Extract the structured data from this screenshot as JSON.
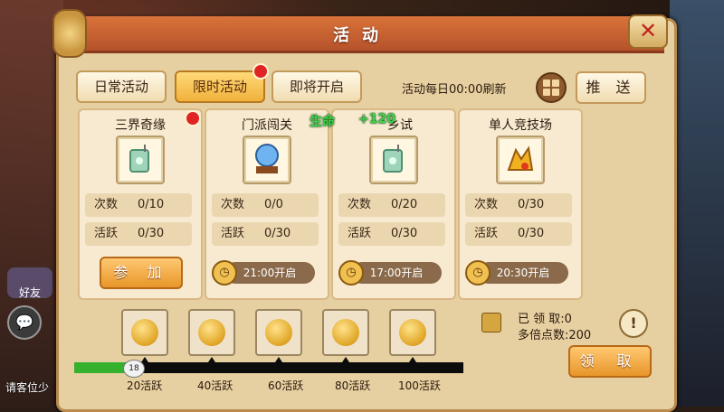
{
  "window": {
    "title": "活动"
  },
  "background": {
    "friend_label": "好友",
    "bottom_left_text": "请客位少"
  },
  "tabs": [
    {
      "label": "日常活动",
      "active": false,
      "red_dot": false
    },
    {
      "label": "限时活动",
      "active": true,
      "red_dot": true
    },
    {
      "label": "即将开启",
      "active": false,
      "red_dot": false
    }
  ],
  "header": {
    "refresh_text": "活动每日00:00刷新",
    "push_label": "推 送",
    "grid_icon": "grid-icon"
  },
  "floating_text": {
    "life": "生命",
    "value": "+120"
  },
  "activities": [
    {
      "name": "三界奇缘",
      "icon": "jade-tag-icon",
      "count_label": "次数",
      "count": "0/10",
      "active_label": "活跃",
      "active": "0/30",
      "action_label": "参 加",
      "red_dot": true
    },
    {
      "name": "门派闯关",
      "icon": "crystal-ball-icon",
      "count_label": "次数",
      "count": "0/0",
      "active_label": "活跃",
      "active": "0/30",
      "time_label": "21:00开启"
    },
    {
      "name": "乡试",
      "icon": "jade-tag-icon",
      "count_label": "次数",
      "count": "0/20",
      "active_label": "活跃",
      "active": "0/30",
      "time_label": "17:00开启"
    },
    {
      "name": "单人竞技场",
      "icon": "golden-dragon-icon",
      "count_label": "次数",
      "count": "0/30",
      "active_label": "活跃",
      "active": "0/30",
      "time_label": "20:30开启"
    }
  ],
  "rewards": {
    "progress": {
      "current": 18,
      "max": 100
    },
    "milestones": [
      {
        "label": "20活跃",
        "value": 20
      },
      {
        "label": "40活跃",
        "value": 40
      },
      {
        "label": "60活跃",
        "value": 60
      },
      {
        "label": "80活跃",
        "value": 80
      },
      {
        "label": "100活跃",
        "value": 100
      }
    ],
    "claimed_label": "已 领 取:0",
    "multiplier_label": "多倍点数:200",
    "claim_button": "领 取",
    "info_button": "!"
  },
  "colors": {
    "accent": "#f0b13b",
    "title_bar": "#c8602f",
    "progress": "#35b12e",
    "red_dot": "#e02424"
  }
}
